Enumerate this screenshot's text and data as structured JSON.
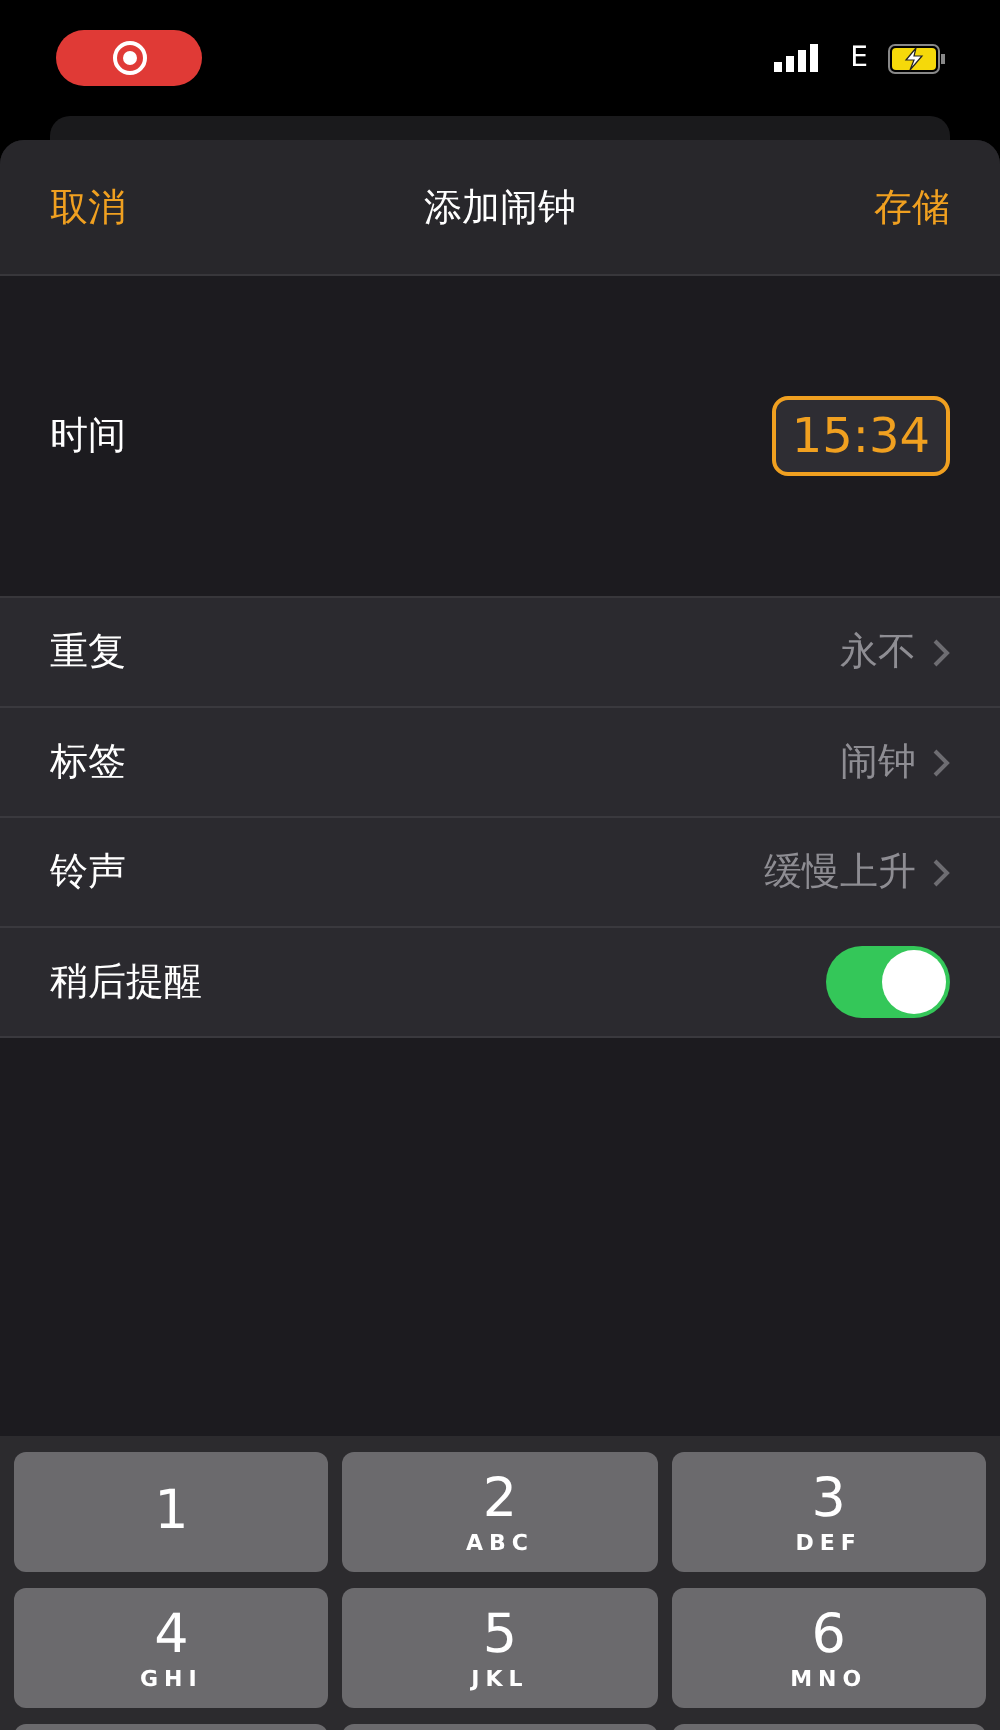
{
  "status_bar": {
    "network": "E"
  },
  "nav": {
    "cancel": "取消",
    "title": "添加闹钟",
    "save": "存储"
  },
  "time_row": {
    "label": "时间",
    "value": "15:34"
  },
  "settings": [
    {
      "kind": "link",
      "label": "重复",
      "value": "永不"
    },
    {
      "kind": "link",
      "label": "标签",
      "value": "闹钟"
    },
    {
      "kind": "link",
      "label": "铃声",
      "value": "缓慢上升"
    },
    {
      "kind": "toggle",
      "label": "稍后提醒",
      "on": true
    }
  ],
  "keypad": [
    {
      "digit": "1"
    },
    {
      "digit": "2",
      "letters": "ABC"
    },
    {
      "digit": "3",
      "letters": "DEF"
    },
    {
      "digit": "4",
      "letters": "GHI"
    },
    {
      "digit": "5",
      "letters": "JKL"
    },
    {
      "digit": "6",
      "letters": "MNO"
    }
  ]
}
